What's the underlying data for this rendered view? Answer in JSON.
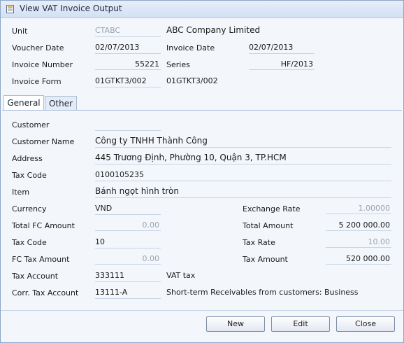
{
  "window": {
    "title": "View VAT Invoice Output"
  },
  "header": {
    "unit_label": "Unit",
    "unit_code": "CTABC",
    "unit_name": "ABC Company Limited",
    "voucher_date_label": "Voucher Date",
    "voucher_date": "02/07/2013",
    "invoice_date_label": "Invoice Date",
    "invoice_date": "02/07/2013",
    "invoice_number_label": "Invoice Number",
    "invoice_number": "55221",
    "series_label": "Series",
    "series": "HF/2013",
    "invoice_form_label": "Invoice Form",
    "invoice_form_code": "01GTKT3/002",
    "invoice_form_name": "01GTKT3/002"
  },
  "tabs": [
    {
      "label": "General",
      "active": true
    },
    {
      "label": "Other",
      "active": false
    }
  ],
  "general": {
    "customer_label": "Customer",
    "customer": "",
    "customer_name_label": "Customer Name",
    "customer_name": "Công ty TNHH Thành Công",
    "address_label": "Address",
    "address": "445 Trương Định, Phường 10, Quận 3, TP.HCM",
    "tax_code_label": "Tax Code",
    "tax_code": "0100105235",
    "item_label": "Item",
    "item": "Bánh ngọt hình tròn",
    "currency_label": "Currency",
    "currency": "VND",
    "exchange_rate_label": "Exchange Rate",
    "exchange_rate": "1.00000",
    "total_fc_label": "Total FC Amount",
    "total_fc": "0.00",
    "total_amount_label": "Total Amount",
    "total_amount": "5 200 000.00",
    "tax_code2_label": "Tax Code",
    "tax_code2": "10",
    "tax_rate_label": "Tax Rate",
    "tax_rate": "10.00",
    "fc_tax_label": "FC Tax Amount",
    "fc_tax": "0.00",
    "tax_amount_label": "Tax Amount",
    "tax_amount": "520 000.00",
    "tax_account_label": "Tax Account",
    "tax_account": "333111",
    "tax_account_name": "VAT tax",
    "corr_tax_account_label": "Corr. Tax Account",
    "corr_tax_account": "13111-A",
    "corr_tax_account_name": "Short-term Receivables from customers: Business"
  },
  "buttons": {
    "new": "New",
    "edit": "Edit",
    "close": "Close"
  },
  "colors": {
    "titlebar": "#d3e1f3",
    "panel": "#f3f7fc",
    "border": "#8ea6c6"
  }
}
